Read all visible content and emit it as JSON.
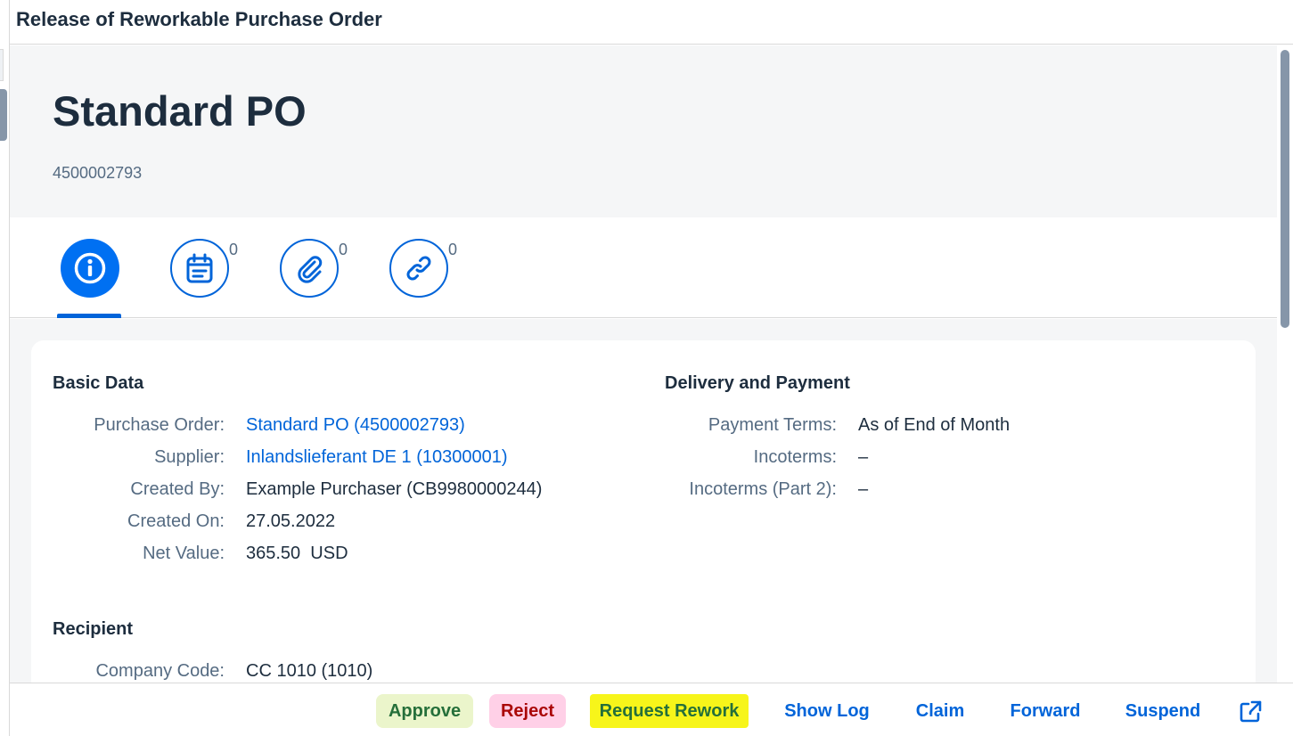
{
  "window": {
    "title": "Release of Reworkable Purchase Order"
  },
  "header": {
    "title": "Standard PO",
    "subtitle": "4500002793"
  },
  "tabs": [
    {
      "icon": "info-icon",
      "count": ""
    },
    {
      "icon": "notes-calendar-icon",
      "count": "0"
    },
    {
      "icon": "attachment-icon",
      "count": "0"
    },
    {
      "icon": "link-icon",
      "count": "0"
    }
  ],
  "basic_data": {
    "title": "Basic Data",
    "fields": [
      {
        "label": "Purchase Order:",
        "value": "Standard PO (4500002793)"
      },
      {
        "label": "Supplier:",
        "value": "Inlandslieferant DE 1 (10300001)"
      },
      {
        "label": "Created By:",
        "value": "Example Purchaser (CB9980000244)"
      },
      {
        "label": "Created On:",
        "value": "27.05.2022"
      },
      {
        "label": "Net Value:",
        "value": "365.50  USD"
      }
    ]
  },
  "delivery_payment": {
    "title": "Delivery and Payment",
    "fields": [
      {
        "label": "Payment Terms:",
        "value": "As of End of Month"
      },
      {
        "label": "Incoterms:",
        "value": "–"
      },
      {
        "label": "Incoterms (Part 2):",
        "value": "–"
      }
    ]
  },
  "recipient": {
    "title": "Recipient",
    "fields": [
      {
        "label": "Company Code:",
        "value": "CC 1010 (1010)"
      }
    ]
  },
  "footer": {
    "approve": "Approve",
    "reject": "Reject",
    "request_rework": "Request Rework",
    "show_log": "Show Log",
    "claim": "Claim",
    "forward": "Forward",
    "suspend": "Suspend",
    "share_icon": "share-icon"
  },
  "colors": {
    "accent": "#0064d9",
    "selected_tab": "#0070f2",
    "approve_bg": "#ebf5cb",
    "reject_bg": "#ffd0e7",
    "highlight": "#f7f51a"
  }
}
